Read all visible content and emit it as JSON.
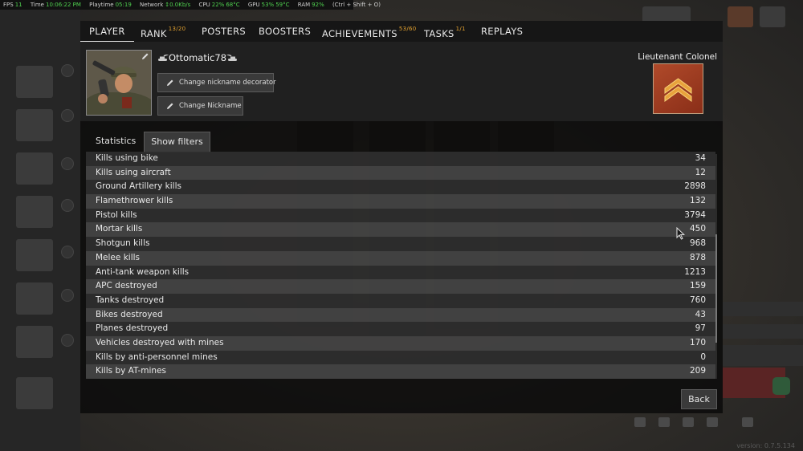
{
  "hud": {
    "fps_label": "FPS",
    "fps": "11",
    "time_label": "Time",
    "time": "10:06:22 PM",
    "playtime_label": "Playtime",
    "playtime": "05:19",
    "network_label": "Network",
    "network": "↕0.0Kb/s",
    "cpu_label": "CPU",
    "cpu_load": "22%",
    "cpu_temp": "68°C",
    "gpu_label": "GPU",
    "gpu_load": "53%",
    "gpu_temp": "59°C",
    "ram_label": "RAM",
    "ram": "92%",
    "shortcut": "(Ctrl + Shift + O)"
  },
  "tabs": [
    {
      "label": "PLAYER",
      "badge": "",
      "active": true
    },
    {
      "label": "RANK",
      "badge": "13/20",
      "active": false
    },
    {
      "label": "POSTERS",
      "badge": "",
      "active": false
    },
    {
      "label": "BOOSTERS",
      "badge": "",
      "active": false
    },
    {
      "label": "ACHIEVEMENTS",
      "badge": "53/60",
      "active": false
    },
    {
      "label": "TASKS",
      "badge": "1/1",
      "active": false
    },
    {
      "label": "REPLAYS",
      "badge": "",
      "active": false
    }
  ],
  "profile": {
    "nickname": "Ottomatic78",
    "change_decorator_label": "Change nickname decorator",
    "change_nickname_label": "Change Nickname",
    "rank_title": "Lieutenant Colonel"
  },
  "statistics": {
    "label": "Statistics",
    "filters_button": "Show filters",
    "rows": [
      {
        "label": "Kills using bike",
        "value": "34"
      },
      {
        "label": "Kills using aircraft",
        "value": "12"
      },
      {
        "label": "Ground Artillery kills",
        "value": "2898"
      },
      {
        "label": "Flamethrower kills",
        "value": "132"
      },
      {
        "label": "Pistol kills",
        "value": "3794"
      },
      {
        "label": "Mortar kills",
        "value": "450"
      },
      {
        "label": "Shotgun kills",
        "value": "968"
      },
      {
        "label": "Melee kills",
        "value": "878"
      },
      {
        "label": "Anti-tank weapon kills",
        "value": "1213"
      },
      {
        "label": "APC destroyed",
        "value": "159"
      },
      {
        "label": "Tanks destroyed",
        "value": "760"
      },
      {
        "label": "Bikes destroyed",
        "value": "43"
      },
      {
        "label": "Planes destroyed",
        "value": "97"
      },
      {
        "label": "Vehicles destroyed with mines",
        "value": "170"
      },
      {
        "label": "Kills by anti-personnel mines",
        "value": "0"
      },
      {
        "label": "Kills by AT-mines",
        "value": "209"
      }
    ]
  },
  "back_button": "Back",
  "version": "version: 0.7.5.134",
  "colors": {
    "accent_badge": "#e0a030",
    "hud_green": "#4fd04f",
    "rank_badge": "#a63e22"
  },
  "icons": [
    "pencil-icon",
    "tank-icon",
    "rank-chevron-icon",
    "cursor-icon"
  ]
}
